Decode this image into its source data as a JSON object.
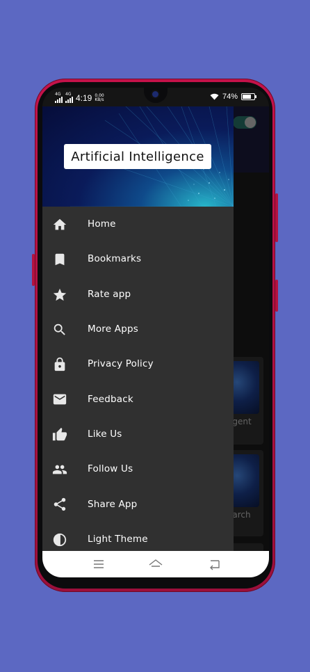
{
  "status_bar": {
    "network_1": "4G",
    "network_2": "4G",
    "time": "4:19",
    "speed_value": "0.00",
    "speed_unit": "KB/s",
    "battery": "74%"
  },
  "drawer": {
    "app_title": "Artificial Intelligence",
    "items": [
      {
        "label": "Home",
        "icon": "home-icon"
      },
      {
        "label": "Bookmarks",
        "icon": "bookmark-icon"
      },
      {
        "label": "Rate app",
        "icon": "star-icon"
      },
      {
        "label": "More Apps",
        "icon": "search-icon"
      },
      {
        "label": "Privacy Policy",
        "icon": "lock-icon"
      },
      {
        "label": "Feedback",
        "icon": "mail-icon"
      },
      {
        "label": "Like Us",
        "icon": "thumb-up-icon"
      },
      {
        "label": "Follow Us",
        "icon": "people-icon"
      },
      {
        "label": "Share App",
        "icon": "share-icon"
      },
      {
        "label": "Light Theme",
        "icon": "contrast-icon"
      }
    ]
  },
  "background_app": {
    "card_1_label": "agent",
    "card_2_label": "earch"
  },
  "colors": {
    "page_background": "#5c68c2",
    "drawer_background": "#303030",
    "phone_frame": "#c4124a"
  }
}
